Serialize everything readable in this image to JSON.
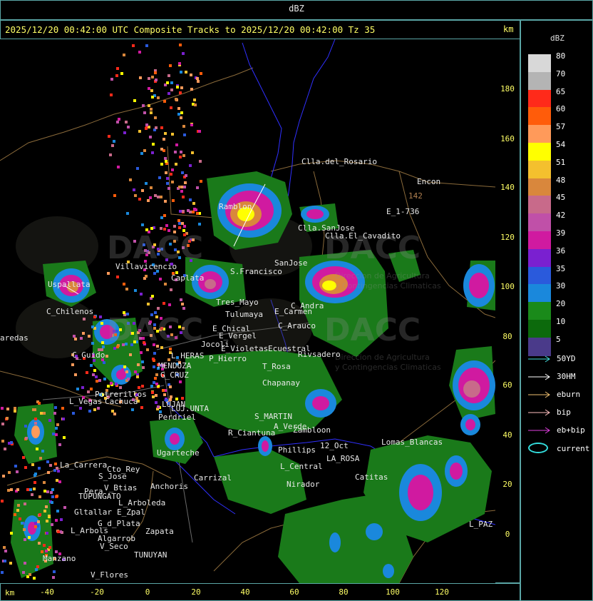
{
  "title": "dBZ",
  "header": "2025/12/20 00:42:00 UTC Composite Tracks to 2025/12/20 00:42:00 Tz 35",
  "axis": {
    "unit_top": "km",
    "unit_bottom": "km",
    "y_ticks": [
      "180",
      "160",
      "140",
      "120",
      "100",
      "80",
      "60",
      "40",
      "20",
      "0"
    ],
    "x_ticks": [
      "-40",
      "-20",
      "0",
      "20",
      "40",
      "60",
      "80",
      "100",
      "120"
    ]
  },
  "legend": {
    "title": "dBZ",
    "scale": [
      {
        "label": "80",
        "color": "#d8d8d8"
      },
      {
        "label": "70",
        "color": "#b4b4b4"
      },
      {
        "label": "65",
        "color": "#ff2a1a"
      },
      {
        "label": "60",
        "color": "#ff5c0a"
      },
      {
        "label": "57",
        "color": "#ff9a5a"
      },
      {
        "label": "54",
        "color": "#ffff00"
      },
      {
        "label": "51",
        "color": "#f4c02e"
      },
      {
        "label": "48",
        "color": "#d9873c"
      },
      {
        "label": "45",
        "color": "#c86a8a"
      },
      {
        "label": "42",
        "color": "#c050a8"
      },
      {
        "label": "39",
        "color": "#d01aa0"
      },
      {
        "label": "36",
        "color": "#7a20d0"
      },
      {
        "label": "35",
        "color": "#2a5adc"
      },
      {
        "label": "30",
        "color": "#1a88dc"
      },
      {
        "label": "20",
        "color": "#1a8a1a"
      },
      {
        "label": "10",
        "color": "#0c6a0c"
      },
      {
        "label": "5",
        "color": "#4a3a8a"
      }
    ],
    "tracks": [
      {
        "label": "50YD",
        "color": "#44dddd"
      },
      {
        "label": "30HM",
        "color": "#ffffff"
      },
      {
        "label": "eburn",
        "color": "#f0c070"
      },
      {
        "label": "bip",
        "color": "#ffc0c0"
      },
      {
        "label": "eb+bip",
        "color": "#e040e0"
      }
    ],
    "current_label": "current",
    "current_color": "#33dddd"
  },
  "watermark": {
    "brand": "DACC",
    "sub1": "Direccion de Agricultura",
    "sub2": "y Contingencias Climaticas"
  },
  "places": [
    {
      "id": "clla-del-rosario",
      "name": "Clla.del_Rosario"
    },
    {
      "id": "encon",
      "name": "Encon"
    },
    {
      "id": "n142",
      "name": "142"
    },
    {
      "id": "e1-736",
      "name": "E_1-736"
    },
    {
      "id": "ramblon",
      "name": "Ramblon"
    },
    {
      "id": "clla-sanjose",
      "name": "Clla.SanJose"
    },
    {
      "id": "clla-el-cavadito",
      "name": "Clla.El_Cavadito"
    },
    {
      "id": "villavicencio",
      "name": "Villavicencio"
    },
    {
      "id": "sanjose",
      "name": "SanJose"
    },
    {
      "id": "s-francisco",
      "name": "S.Francisco"
    },
    {
      "id": "uspallata",
      "name": "Uspallata"
    },
    {
      "id": "caplata",
      "name": "Caplata"
    },
    {
      "id": "tres-mayo",
      "name": "Tres_Mayo"
    },
    {
      "id": "c-andra",
      "name": "C_Andra"
    },
    {
      "id": "e-carmen",
      "name": "E_Carmen"
    },
    {
      "id": "c-chilenos",
      "name": "C_Chilenos"
    },
    {
      "id": "tulumaya",
      "name": "Tulumaya"
    },
    {
      "id": "c-arauco",
      "name": "C_Arauco"
    },
    {
      "id": "e-chical",
      "name": "E_Chical"
    },
    {
      "id": "e-vergel",
      "name": "E_Vergel"
    },
    {
      "id": "paredas",
      "name": "aredas"
    },
    {
      "id": "jocoli",
      "name": "Jocoli"
    },
    {
      "id": "e-violetas",
      "name": "E_Violetas"
    },
    {
      "id": "ecuestral",
      "name": "Ecuestral"
    },
    {
      "id": "rivsadero",
      "name": "Rivsadero"
    },
    {
      "id": "c-guido",
      "name": "C_Guido"
    },
    {
      "id": "l-heras",
      "name": "L_HERAS"
    },
    {
      "id": "p-hierro",
      "name": "P_Hierro"
    },
    {
      "id": "mendoza",
      "name": "MENDOZA"
    },
    {
      "id": "g-cruz",
      "name": "G_CRUZ"
    },
    {
      "id": "t-rosa",
      "name": "T_Rosa"
    },
    {
      "id": "chapanay",
      "name": "Chapanay"
    },
    {
      "id": "potrerillos",
      "name": "Potrerillos"
    },
    {
      "id": "l-vegas",
      "name": "L_Vegas"
    },
    {
      "id": "cachuca",
      "name": "Cachuca"
    },
    {
      "id": "lujan",
      "name": "LUJAN"
    },
    {
      "id": "luj-munta",
      "name": "LUJ.UNTA"
    },
    {
      "id": "perdriel",
      "name": "Perdriel"
    },
    {
      "id": "s-martin",
      "name": "S_MARTIN"
    },
    {
      "id": "a-verde",
      "name": "A_Verde"
    },
    {
      "id": "zambloon",
      "name": "Zambloon"
    },
    {
      "id": "r-ciantuna",
      "name": "R_Ciantuna"
    },
    {
      "id": "ugarteche",
      "name": "Ugarteche"
    },
    {
      "id": "phillips",
      "name": "Phillips"
    },
    {
      "id": "oct12",
      "name": "12_Oct"
    },
    {
      "id": "lomas-blancas",
      "name": "Lomas_Blancas"
    },
    {
      "id": "la-carrera",
      "name": "La_Carrera"
    },
    {
      "id": "cto-rey",
      "name": "Cto_Rey"
    },
    {
      "id": "s-jose",
      "name": "S_Jose"
    },
    {
      "id": "l-central",
      "name": "L_Central"
    },
    {
      "id": "carrizal",
      "name": "Carrizal"
    },
    {
      "id": "nirador",
      "name": "Nirador"
    },
    {
      "id": "la-rosa",
      "name": "LA_ROSA"
    },
    {
      "id": "catitas",
      "name": "Catitas"
    },
    {
      "id": "v-btias",
      "name": "V_Btias"
    },
    {
      "id": "anchoris",
      "name": "Anchoris"
    },
    {
      "id": "pera",
      "name": "Pera"
    },
    {
      "id": "tupungato",
      "name": "TUPUNGATO"
    },
    {
      "id": "l-arboleda",
      "name": "L_Arboleda"
    },
    {
      "id": "gltallar",
      "name": "Gltallar"
    },
    {
      "id": "e-zpal",
      "name": "E_Zpal"
    },
    {
      "id": "g-d-plata",
      "name": "G_d_Plata"
    },
    {
      "id": "l-arbols",
      "name": "L_Arbols"
    },
    {
      "id": "zapata",
      "name": "Zapata"
    },
    {
      "id": "algarrob",
      "name": "Algarrob"
    },
    {
      "id": "v-seco",
      "name": "V_Seco"
    },
    {
      "id": "tunuyan",
      "name": "TUNUYAN"
    },
    {
      "id": "l-paz",
      "name": "L_PAZ"
    },
    {
      "id": "manzano",
      "name": "Manzano"
    },
    {
      "id": "v-flores",
      "name": "V_Flores"
    }
  ]
}
